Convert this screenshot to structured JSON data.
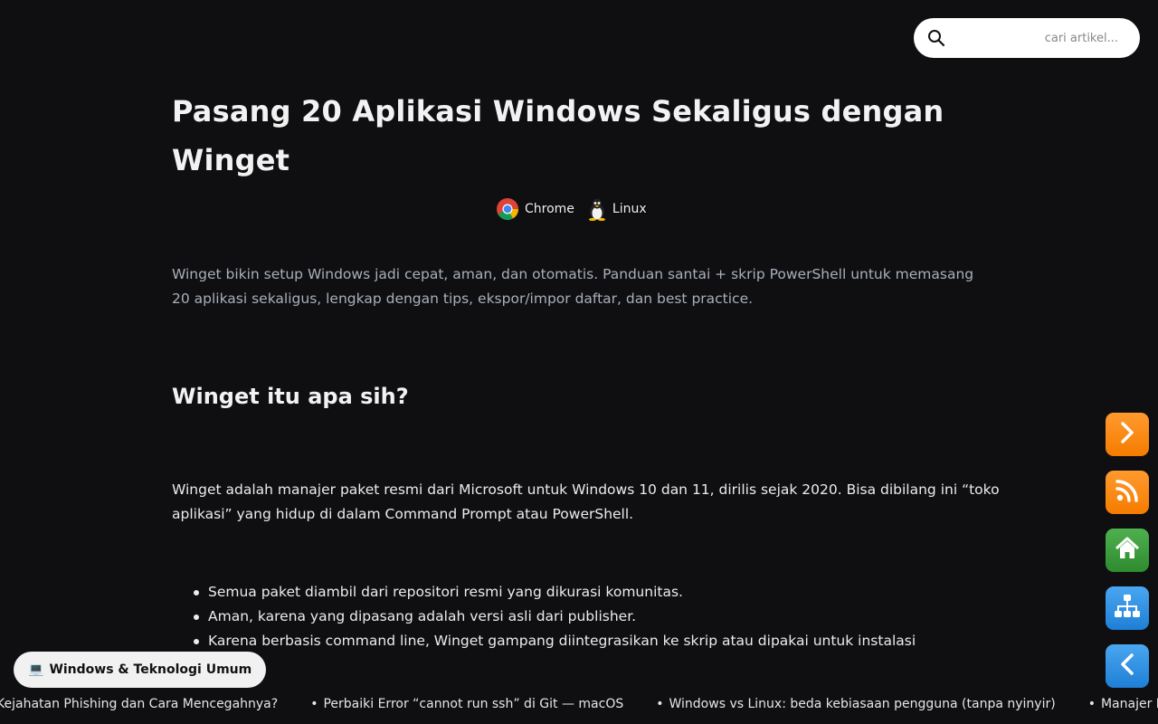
{
  "search": {
    "placeholder": "cari artikel..."
  },
  "article": {
    "title": "Pasang 20 Aplikasi Windows Sekaligus dengan Winget",
    "tags": [
      {
        "label": "Chrome",
        "icon": "chrome-icon"
      },
      {
        "label": "Linux",
        "icon": "tux-icon"
      }
    ],
    "lead": "Winget bikin setup Windows jadi cepat, aman, dan otomatis. Panduan santai + skrip PowerShell untuk memasang 20 aplikasi sekaligus, lengkap dengan tips, ekspor/impor daftar, dan best practice.",
    "section_heading": "Winget itu apa sih?",
    "paragraph": "Winget adalah manajer paket resmi dari Microsoft untuk Windows 10 dan 11, dirilis sejak 2020. Bisa dibilang ini “toko aplikasi” yang hidup di dalam Command Prompt atau PowerShell.",
    "bullets": [
      "Semua paket diambil dari repositori resmi yang dikurasi komunitas.",
      "Aman, karena yang dipasang adalah versi asli dari publisher.",
      "Karena berbasis command line, Winget gampang diintegrasikan ke skrip atau dipakai untuk instalasi"
    ]
  },
  "category_pill": {
    "emoji": "💻",
    "label": "Windows & Teknologi Umum"
  },
  "side_buttons": [
    {
      "name": "next-button",
      "icon": "chevron-right-icon",
      "color": "#f57c00"
    },
    {
      "name": "rss-button",
      "icon": "rss-icon",
      "color": "#f57c00"
    },
    {
      "name": "home-button",
      "icon": "home-icon",
      "color": "#2e8b2e"
    },
    {
      "name": "sitemap-button",
      "icon": "sitemap-icon",
      "color": "#1e7fd6"
    },
    {
      "name": "back-button",
      "icon": "chevron-left-icon",
      "color": "#1e7fd6"
    }
  ],
  "ticker": {
    "items": [
      "Kejahatan Phishing dan Cara Mencegahnya?",
      "Perbaiki Error “cannot run ssh” di Git — macOS",
      "Windows vs Linux: beda kebiasaan pengguna (tanpa nyinyir)",
      "Manajer Kata Sandi"
    ]
  }
}
